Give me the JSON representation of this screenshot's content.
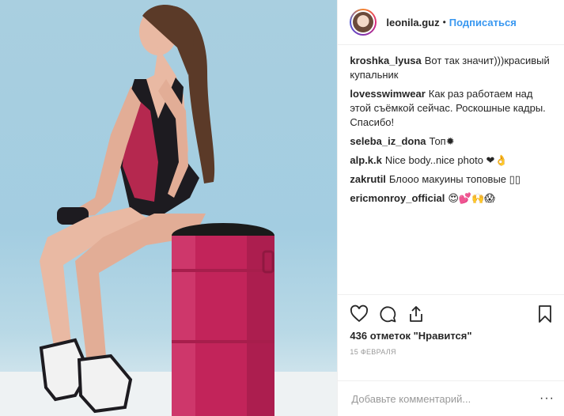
{
  "header": {
    "username": "leonila.guz",
    "separator": "•",
    "follow_label": "Подписаться"
  },
  "comments": [
    {
      "user": "kroshka_lyusa",
      "text": "Вот так значит)))красивый купальник"
    },
    {
      "user": "lovesswimwear",
      "text": "Как раз работаем над этой съёмкой сейчас. Роскошные кадры. Спасибо!"
    },
    {
      "user": "seleba_iz_dona",
      "text": "Топ✹"
    },
    {
      "user": "alp.k.k",
      "text": "Nice body..nice photo ❤👌"
    },
    {
      "user": "zakrutil",
      "text": "Блооо макуины топовые ▯▯"
    },
    {
      "user": "ericmonroy_official",
      "text": "😍💕🙌😱"
    }
  ],
  "icons": {
    "like": "heart-icon",
    "comment": "speech-bubble-icon",
    "share": "share-icon",
    "save": "bookmark-icon",
    "more": "ellipsis-icon"
  },
  "likes_text": "436 отметок \"Нравится\"",
  "date_text": "15 февраля",
  "add_comment": {
    "placeholder": "Добавьте комментарий...",
    "more_label": "···"
  },
  "colors": {
    "accent": "#3897f0",
    "text": "#262626",
    "muted": "#999999"
  }
}
